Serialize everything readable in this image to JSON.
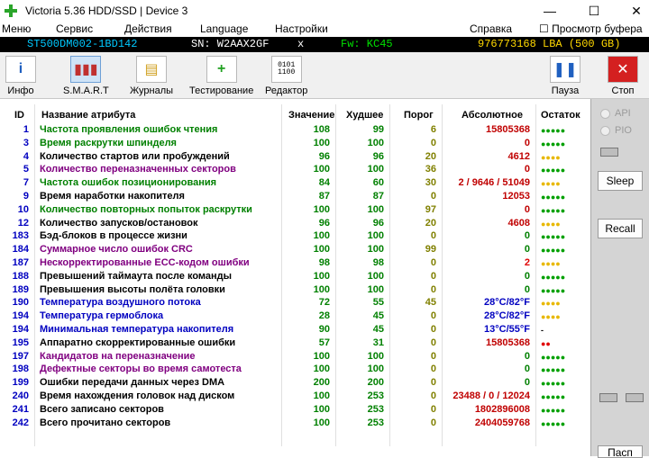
{
  "window": {
    "title": "Victoria 5.36 HDD/SSD | Device 3",
    "minimize": "—",
    "maximize": "☐",
    "close": "✕"
  },
  "menu": [
    "Меню",
    "Сервис",
    "Действия",
    "Language",
    "Настройки",
    "Справка",
    "☐ Просмотр буфера"
  ],
  "info": {
    "model": "ST500DM002-1BD142",
    "serial": "SN: W2AAX2GF",
    "x": "x",
    "firmware": "Fw: KC45",
    "lba": "976773168 LBA (500 GB)"
  },
  "toolbar": {
    "info": "Инфо",
    "smart": "S.M.A.R.T",
    "journals": "Журналы",
    "testing": "Тестирование",
    "editor": "Редактор",
    "pause": "Пауза",
    "stop": "Стоп"
  },
  "side": {
    "api": "API",
    "pio": "PIO",
    "sleep": "Sleep",
    "recall": "Recall",
    "passport": "Пасп"
  },
  "table": {
    "headers": {
      "id": "ID",
      "name": "Название атрибута",
      "value": "Значение",
      "worst": "Худшее",
      "threshold": "Порог",
      "raw": "Абсолютное",
      "rest": "Остаток"
    },
    "rows": [
      {
        "id": "1",
        "name": "Частота проявления ошибок чтения",
        "value": "108",
        "worst": "99",
        "thr": "6",
        "raw": "15805368",
        "rest": "●●●●●",
        "nameColor": "#008000",
        "rawColor": "#c00000",
        "restColor": "#00a000"
      },
      {
        "id": "3",
        "name": "Время раскрутки шпинделя",
        "value": "100",
        "worst": "100",
        "thr": "0",
        "raw": "0",
        "rest": "●●●●●",
        "nameColor": "#008000",
        "rawColor": "#c00000",
        "restColor": "#00a000"
      },
      {
        "id": "4",
        "name": "Количество стартов или пробуждений",
        "value": "96",
        "worst": "96",
        "thr": "20",
        "raw": "4612",
        "rest": "●●●●",
        "nameColor": "#000000",
        "rawColor": "#c00000",
        "restColor": "#e8b800"
      },
      {
        "id": "5",
        "name": "Количество переназначенных секторов",
        "value": "100",
        "worst": "100",
        "thr": "36",
        "raw": "0",
        "rest": "●●●●●",
        "nameColor": "#800080",
        "rawColor": "#c00000",
        "restColor": "#00a000"
      },
      {
        "id": "7",
        "name": "Частота ошибок позиционирования",
        "value": "84",
        "worst": "60",
        "thr": "30",
        "raw": "2 / 9646 / 51049",
        "rest": "●●●●",
        "nameColor": "#008000",
        "rawColor": "#c00000",
        "restColor": "#e8b800"
      },
      {
        "id": "9",
        "name": "Время наработки накопителя",
        "value": "87",
        "worst": "87",
        "thr": "0",
        "raw": "12053",
        "rest": "●●●●●",
        "nameColor": "#000000",
        "rawColor": "#c00000",
        "restColor": "#00a000"
      },
      {
        "id": "10",
        "name": "Количество повторных попыток раскрутки",
        "value": "100",
        "worst": "100",
        "thr": "97",
        "raw": "0",
        "rest": "●●●●●",
        "nameColor": "#008000",
        "rawColor": "#c00000",
        "restColor": "#00a000"
      },
      {
        "id": "12",
        "name": "Количество запусков/остановок",
        "value": "96",
        "worst": "96",
        "thr": "20",
        "raw": "4608",
        "rest": "●●●●",
        "nameColor": "#000000",
        "rawColor": "#c00000",
        "restColor": "#e8b800"
      },
      {
        "id": "183",
        "name": "Бэд-блоков в процессе жизни",
        "value": "100",
        "worst": "100",
        "thr": "0",
        "raw": "0",
        "rest": "●●●●●",
        "nameColor": "#000000",
        "rawColor": "#008000",
        "restColor": "#00a000"
      },
      {
        "id": "184",
        "name": "Суммарное число ошибок CRC",
        "value": "100",
        "worst": "100",
        "thr": "99",
        "raw": "0",
        "rest": "●●●●●",
        "nameColor": "#800080",
        "rawColor": "#008000",
        "restColor": "#00a000"
      },
      {
        "id": "187",
        "name": "Нескорректированные ECC-кодом ошибки",
        "value": "98",
        "worst": "98",
        "thr": "0",
        "raw": "2",
        "rest": "●●●●",
        "nameColor": "#800080",
        "rawColor": "#e00000",
        "restColor": "#e8b800"
      },
      {
        "id": "188",
        "name": "Превышений таймаута после команды",
        "value": "100",
        "worst": "100",
        "thr": "0",
        "raw": "0",
        "rest": "●●●●●",
        "nameColor": "#000000",
        "rawColor": "#008000",
        "restColor": "#00a000"
      },
      {
        "id": "189",
        "name": "Превышения высоты полёта головки",
        "value": "100",
        "worst": "100",
        "thr": "0",
        "raw": "0",
        "rest": "●●●●●",
        "nameColor": "#000000",
        "rawColor": "#008000",
        "restColor": "#00a000"
      },
      {
        "id": "190",
        "name": "Температура воздушного потока",
        "value": "72",
        "worst": "55",
        "thr": "45",
        "raw": "28°C/82°F",
        "rest": "●●●●",
        "nameColor": "#0000c0",
        "rawColor": "#0000c0",
        "restColor": "#e8b800"
      },
      {
        "id": "194",
        "name": "Температура гермоблока",
        "value": "28",
        "worst": "45",
        "thr": "0",
        "raw": "28°C/82°F",
        "rest": "●●●●",
        "nameColor": "#0000c0",
        "rawColor": "#0000c0",
        "restColor": "#e8b800"
      },
      {
        "id": "194",
        "name": "Минимальная температура накопителя",
        "value": "90",
        "worst": "45",
        "thr": "0",
        "raw": "13°C/55°F",
        "rest": "-",
        "nameColor": "#0000c0",
        "rawColor": "#0000c0",
        "restColor": "#000000"
      },
      {
        "id": "195",
        "name": "Аппаратно скорректированные ошибки",
        "value": "57",
        "worst": "31",
        "thr": "0",
        "raw": "15805368",
        "rest": "●●",
        "nameColor": "#000000",
        "rawColor": "#c00000",
        "restColor": "#e00000"
      },
      {
        "id": "197",
        "name": "Кандидатов на переназначение",
        "value": "100",
        "worst": "100",
        "thr": "0",
        "raw": "0",
        "rest": "●●●●●",
        "nameColor": "#800080",
        "rawColor": "#008000",
        "restColor": "#00a000"
      },
      {
        "id": "198",
        "name": "Дефектные секторы во время самотеста",
        "value": "100",
        "worst": "100",
        "thr": "0",
        "raw": "0",
        "rest": "●●●●●",
        "nameColor": "#800080",
        "rawColor": "#008000",
        "restColor": "#00a000"
      },
      {
        "id": "199",
        "name": "Ошибки передачи данных через DMA",
        "value": "200",
        "worst": "200",
        "thr": "0",
        "raw": "0",
        "rest": "●●●●●",
        "nameColor": "#000000",
        "rawColor": "#008000",
        "restColor": "#00a000"
      },
      {
        "id": "240",
        "name": "Время нахождения головок над диском",
        "value": "100",
        "worst": "253",
        "thr": "0",
        "raw": "23488 / 0 / 12024",
        "rest": "●●●●●",
        "nameColor": "#000000",
        "rawColor": "#c00000",
        "restColor": "#00a000"
      },
      {
        "id": "241",
        "name": "Всего записано секторов",
        "value": "100",
        "worst": "253",
        "thr": "0",
        "raw": "1802896008",
        "rest": "●●●●●",
        "nameColor": "#000000",
        "rawColor": "#c00000",
        "restColor": "#00a000"
      },
      {
        "id": "242",
        "name": "Всего прочитано секторов",
        "value": "100",
        "worst": "253",
        "thr": "0",
        "raw": "2404059768",
        "rest": "●●●●●",
        "nameColor": "#000000",
        "rawColor": "#c00000",
        "restColor": "#00a000"
      }
    ]
  }
}
